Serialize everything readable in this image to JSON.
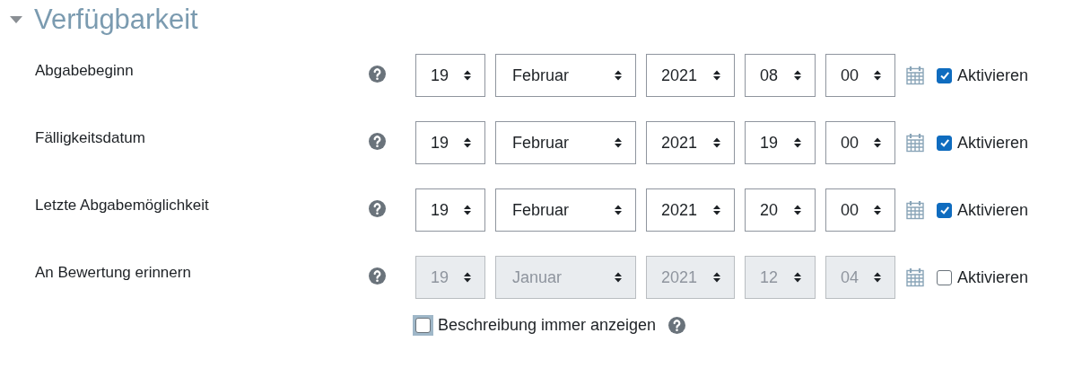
{
  "section": {
    "title": "Verfügbarkeit",
    "expanded": true
  },
  "rows": [
    {
      "label": "Abgabebeginn",
      "fields": [
        "19",
        "Februar",
        "2021",
        "08",
        "00"
      ],
      "checkbox": {
        "label": "Aktivieren",
        "checked": true
      }
    },
    {
      "label": "Fälligkeitsdatum",
      "fields": [
        "19",
        "Februar",
        "2021",
        "19",
        "00"
      ],
      "checkbox": {
        "label": "Aktivieren",
        "checked": true
      }
    },
    {
      "label": "Letzte Abgabemöglichkeit",
      "fields": [
        "19",
        "Februar",
        "2021",
        "20",
        "00"
      ],
      "checkbox": {
        "label": "Aktivieren",
        "checked": true
      }
    },
    {
      "label": "An Bewertung erinnern",
      "fields": [
        "19",
        "Januar",
        "2021",
        "12",
        "04"
      ],
      "checkbox": {
        "label": "Aktivieren",
        "checked": false
      }
    }
  ],
  "option": {
    "label": "Beschreibung immer anzeigen",
    "checked": false,
    "focused": true
  }
}
